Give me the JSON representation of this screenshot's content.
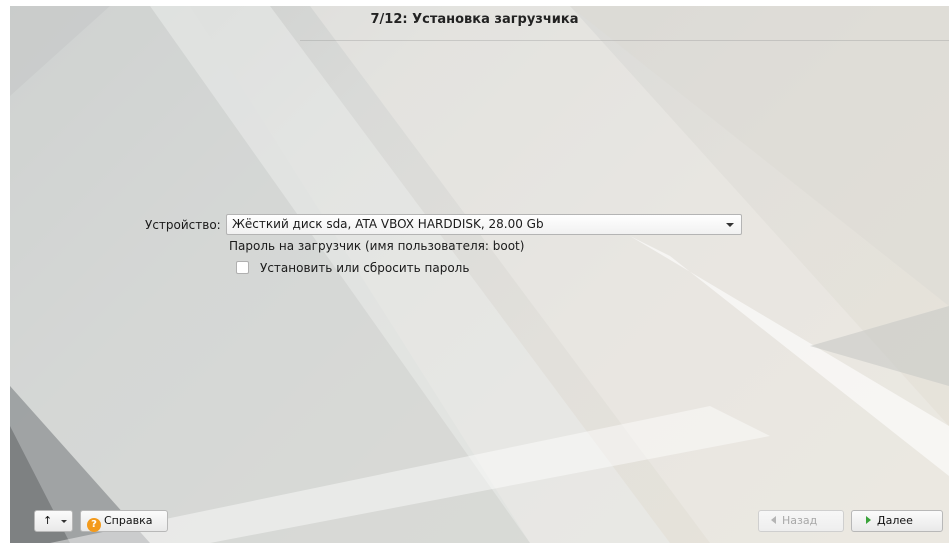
{
  "window": {
    "title": "7/12: Установка загрузчика"
  },
  "form": {
    "device_label": "Устройство:",
    "device_value": "Жёсткий диск sda, ATA VBOX HARDDISK, 28.00 Gb",
    "bootloader_password_label": "Пароль на загрузчик (имя пользователя: boot)",
    "set_password_label": "Установить или сбросить пароль",
    "set_password_checked": false
  },
  "footer": {
    "up_icon": "↑",
    "help_icon": "?",
    "help_label": "Справка",
    "back_label": "Назад",
    "back_enabled": false,
    "next_label": "Далее"
  },
  "icons": {
    "up": "up-arrow-icon",
    "dropdown": "chevron-down-icon",
    "help": "question-circle-icon",
    "back": "triangle-left-icon",
    "next": "triangle-right-icon"
  },
  "colors": {
    "help_icon": "#f39a1c",
    "next_icon": "#3aa33a",
    "disabled_text": "#a8a8a8"
  }
}
